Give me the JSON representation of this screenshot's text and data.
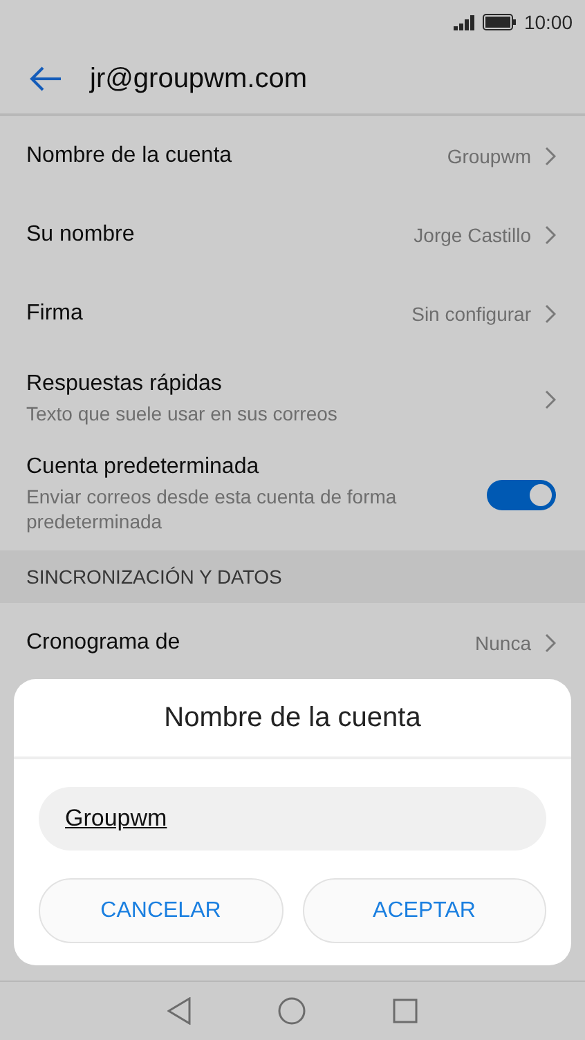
{
  "status_bar": {
    "time": "10:00"
  },
  "header": {
    "title": "jr@groupwm.com"
  },
  "settings": [
    {
      "kind": "link",
      "label": "Nombre de la cuenta",
      "value": "Groupwm"
    },
    {
      "kind": "link",
      "label": "Su nombre",
      "value": "Jorge Castillo"
    },
    {
      "kind": "link",
      "label": "Firma",
      "value": "Sin configurar"
    },
    {
      "kind": "link",
      "label": "Respuestas rápidas",
      "subtitle": "Texto que suele usar en sus correos"
    },
    {
      "kind": "toggle",
      "label": "Cuenta predeterminada",
      "subtitle": "Enviar correos desde esta cuenta de forma predeterminada",
      "on": true
    },
    {
      "kind": "section",
      "label": "SINCRONIZACIÓN Y DATOS"
    },
    {
      "kind": "link",
      "label": "Cronograma de",
      "value": "Nunca"
    }
  ],
  "dialog": {
    "title": "Nombre de la cuenta",
    "field_value": "Groupwm",
    "buttons": [
      "CANCELAR",
      "ACEPTAR"
    ]
  }
}
